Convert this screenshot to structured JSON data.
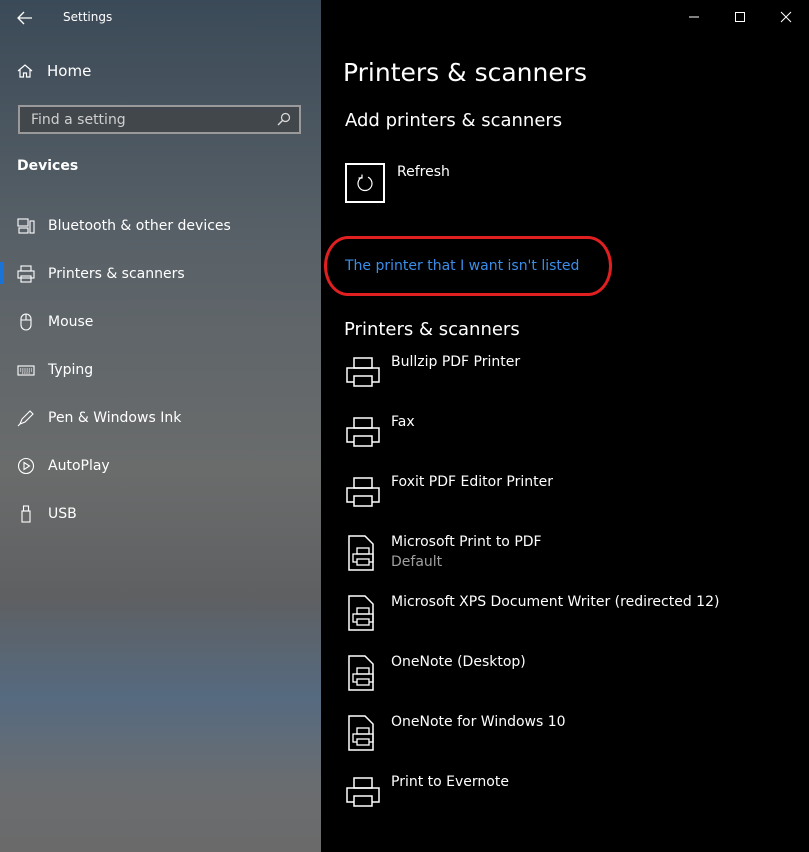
{
  "window": {
    "title": "Settings"
  },
  "sidebar": {
    "home": "Home",
    "search_placeholder": "Find a setting",
    "section": "Devices",
    "items": [
      {
        "label": "Bluetooth & other devices",
        "icon": "bluetooth-devices-icon"
      },
      {
        "label": "Printers & scanners",
        "icon": "printer-icon",
        "active": true
      },
      {
        "label": "Mouse",
        "icon": "mouse-icon"
      },
      {
        "label": "Typing",
        "icon": "keyboard-icon"
      },
      {
        "label": "Pen & Windows Ink",
        "icon": "pen-icon"
      },
      {
        "label": "AutoPlay",
        "icon": "autoplay-icon"
      },
      {
        "label": "USB",
        "icon": "usb-icon"
      }
    ]
  },
  "main": {
    "title": "Printers & scanners",
    "add_heading": "Add printers & scanners",
    "refresh_label": "Refresh",
    "link_text": "The printer that I want isn't listed",
    "list_heading": "Printers & scanners",
    "printers": [
      {
        "name": "Bullzip PDF Printer",
        "status": "",
        "icon": "printer"
      },
      {
        "name": "Fax",
        "status": "",
        "icon": "printer"
      },
      {
        "name": "Foxit PDF Editor Printer",
        "status": "",
        "icon": "printer"
      },
      {
        "name": "Microsoft Print to PDF",
        "status": "Default",
        "icon": "document-printer"
      },
      {
        "name": "Microsoft XPS Document Writer (redirected 12)",
        "status": "",
        "icon": "document-printer"
      },
      {
        "name": "OneNote (Desktop)",
        "status": "",
        "icon": "document-printer"
      },
      {
        "name": "OneNote for Windows 10",
        "status": "",
        "icon": "document-printer"
      },
      {
        "name": "Print to Evernote",
        "status": "",
        "icon": "printer"
      }
    ]
  },
  "colors": {
    "accent": "#1a74d8",
    "link": "#3b8eea",
    "highlight": "#e02020"
  }
}
